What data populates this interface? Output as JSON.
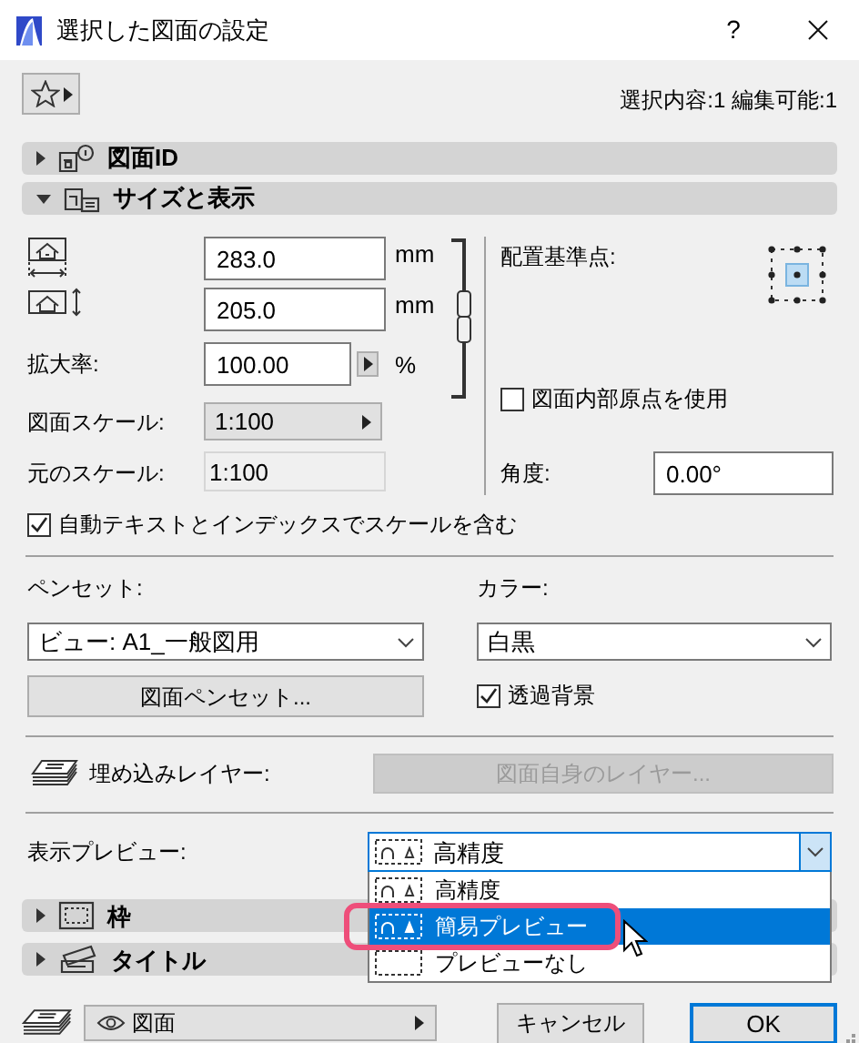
{
  "window": {
    "title": "選択した図面の設定",
    "help": "?"
  },
  "selection_info": "選択内容:1 編集可能:1",
  "sections": [
    {
      "title": "図面ID",
      "kind": "id",
      "expanded": false
    },
    {
      "title": "サイズと表示",
      "kind": "size",
      "expanded": true
    }
  ],
  "size": {
    "width": {
      "value": "283.0",
      "unit": "mm"
    },
    "height": {
      "value": "205.0",
      "unit": "mm"
    },
    "scale_percent": {
      "label": "拡大率:",
      "value": "100.00",
      "unit": "%"
    },
    "drawing_scale": {
      "label": "図面スケール:",
      "value": "1:100"
    },
    "original_scale": {
      "label": "元のスケール:",
      "value": "1:100"
    },
    "anchor_label": "配置基準点:",
    "use_origin": {
      "label": "図面内部原点を使用",
      "checked": false
    },
    "angle": {
      "label": "角度:",
      "value": "0.00°"
    }
  },
  "auto_text": {
    "label": "自動テキストとインデックスでスケールを含む",
    "checked": true
  },
  "pens": {
    "pen_set_label": "ペンセット:",
    "pen_set": "ビュー: A1_一般図用",
    "pen_button": "図面ペンセット...",
    "color_label": "カラー:",
    "color_setting": "白黒",
    "transparent": {
      "label": "透過背景",
      "checked": true
    }
  },
  "layers": {
    "label": "埋め込みレイヤー:",
    "button": {
      "label": "図面自身のレイヤー...",
      "disabled": true
    }
  },
  "preview": {
    "label": "表示プレビュー:",
    "value": "高精度",
    "open": true,
    "options": [
      {
        "label": "高精度",
        "highlighted": false
      },
      {
        "label": "簡易プレビュー",
        "highlighted": true
      },
      {
        "label": "プレビューなし",
        "highlighted": false
      }
    ]
  },
  "lower_sections": [
    {
      "title": "枠",
      "kind": "frame",
      "expanded": false
    },
    {
      "title": "タイトル",
      "kind": "title",
      "expanded": false
    }
  ],
  "footer": {
    "layer": "図面",
    "cancel": "キャンセル",
    "ok": "OK"
  }
}
